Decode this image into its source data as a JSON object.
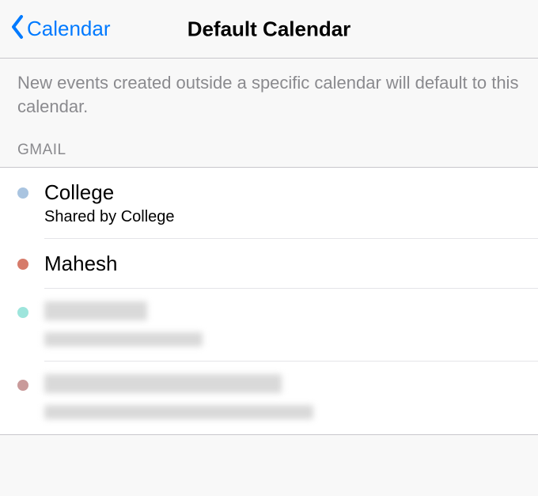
{
  "nav": {
    "back_label": "Calendar",
    "title": "Default Calendar"
  },
  "description": "New events created outside a specific calendar will default to this calendar.",
  "section": {
    "header": "GMAIL",
    "items": [
      {
        "color": "#a9c4e0",
        "title": "College",
        "subtitle": "Shared by College",
        "redacted": false
      },
      {
        "color": "#d67b6a",
        "title": "Mahesh",
        "subtitle": "",
        "redacted": false
      },
      {
        "color": "#9de5dc",
        "title": "",
        "subtitle": "",
        "redacted": true
      },
      {
        "color": "#c99a9a",
        "title": "",
        "subtitle": "",
        "redacted": true
      }
    ]
  }
}
